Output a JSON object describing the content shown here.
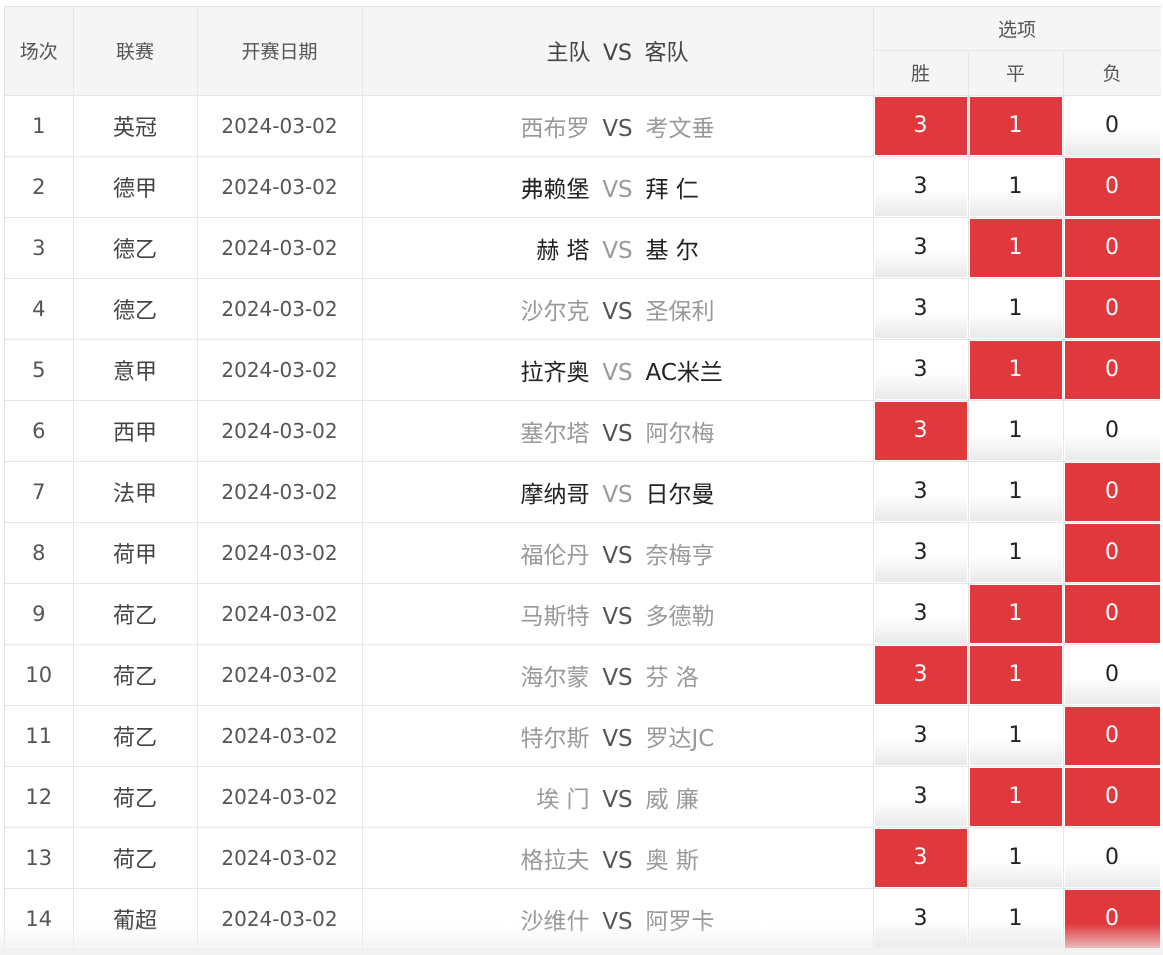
{
  "header": {
    "index": "场次",
    "league": "联赛",
    "date": "开赛日期",
    "teams_home": "主队",
    "teams_vs": "VS",
    "teams_away": "客队",
    "options": "选项",
    "win": "胜",
    "draw": "平",
    "lose": "负"
  },
  "colors": {
    "selected": "#e0393d",
    "header_bg": "#f5f5f5"
  },
  "rows": [
    {
      "index": "1",
      "league": "英冠",
      "date": "2024-03-02",
      "home": "西布罗",
      "vs": "VS",
      "away": "考文垂",
      "w": "3",
      "d": "1",
      "l": "0",
      "sel": [
        true,
        true,
        false
      ],
      "homeDim": true,
      "awayDim": true
    },
    {
      "index": "2",
      "league": "德甲",
      "date": "2024-03-02",
      "home": "弗赖堡",
      "vs": "VS",
      "away": "拜 仁",
      "w": "3",
      "d": "1",
      "l": "0",
      "sel": [
        false,
        false,
        true
      ],
      "homeDim": false,
      "awayDim": false
    },
    {
      "index": "3",
      "league": "德乙",
      "date": "2024-03-02",
      "home": "赫 塔",
      "vs": "VS",
      "away": "基 尔",
      "w": "3",
      "d": "1",
      "l": "0",
      "sel": [
        false,
        true,
        true
      ],
      "homeDim": false,
      "awayDim": false
    },
    {
      "index": "4",
      "league": "德乙",
      "date": "2024-03-02",
      "home": "沙尔克",
      "vs": "VS",
      "away": "圣保利",
      "w": "3",
      "d": "1",
      "l": "0",
      "sel": [
        false,
        false,
        true
      ],
      "homeDim": true,
      "awayDim": true
    },
    {
      "index": "5",
      "league": "意甲",
      "date": "2024-03-02",
      "home": "拉齐奥",
      "vs": "VS",
      "away": "AC米兰",
      "w": "3",
      "d": "1",
      "l": "0",
      "sel": [
        false,
        true,
        true
      ],
      "homeDim": false,
      "awayDim": false
    },
    {
      "index": "6",
      "league": "西甲",
      "date": "2024-03-02",
      "home": "塞尔塔",
      "vs": "VS",
      "away": "阿尔梅",
      "w": "3",
      "d": "1",
      "l": "0",
      "sel": [
        true,
        false,
        false
      ],
      "homeDim": true,
      "awayDim": true
    },
    {
      "index": "7",
      "league": "法甲",
      "date": "2024-03-02",
      "home": "摩纳哥",
      "vs": "VS",
      "away": "日尔曼",
      "w": "3",
      "d": "1",
      "l": "0",
      "sel": [
        false,
        false,
        true
      ],
      "homeDim": false,
      "awayDim": false
    },
    {
      "index": "8",
      "league": "荷甲",
      "date": "2024-03-02",
      "home": "福伦丹",
      "vs": "VS",
      "away": "奈梅亨",
      "w": "3",
      "d": "1",
      "l": "0",
      "sel": [
        false,
        false,
        true
      ],
      "homeDim": true,
      "awayDim": true
    },
    {
      "index": "9",
      "league": "荷乙",
      "date": "2024-03-02",
      "home": "马斯特",
      "vs": "VS",
      "away": "多德勒",
      "w": "3",
      "d": "1",
      "l": "0",
      "sel": [
        false,
        true,
        true
      ],
      "homeDim": true,
      "awayDim": true
    },
    {
      "index": "10",
      "league": "荷乙",
      "date": "2024-03-02",
      "home": "海尔蒙",
      "vs": "VS",
      "away": "芬 洛",
      "w": "3",
      "d": "1",
      "l": "0",
      "sel": [
        true,
        true,
        false
      ],
      "homeDim": true,
      "awayDim": true
    },
    {
      "index": "11",
      "league": "荷乙",
      "date": "2024-03-02",
      "home": "特尔斯",
      "vs": "VS",
      "away": "罗达JC",
      "w": "3",
      "d": "1",
      "l": "0",
      "sel": [
        false,
        false,
        true
      ],
      "homeDim": true,
      "awayDim": true
    },
    {
      "index": "12",
      "league": "荷乙",
      "date": "2024-03-02",
      "home": "埃 门",
      "vs": "VS",
      "away": "威 廉",
      "w": "3",
      "d": "1",
      "l": "0",
      "sel": [
        false,
        true,
        true
      ],
      "homeDim": true,
      "awayDim": true
    },
    {
      "index": "13",
      "league": "荷乙",
      "date": "2024-03-02",
      "home": "格拉夫",
      "vs": "VS",
      "away": "奥 斯",
      "w": "3",
      "d": "1",
      "l": "0",
      "sel": [
        true,
        false,
        false
      ],
      "homeDim": true,
      "awayDim": true
    },
    {
      "index": "14",
      "league": "葡超",
      "date": "2024-03-02",
      "home": "沙维什",
      "vs": "VS",
      "away": "阿罗卡",
      "w": "3",
      "d": "1",
      "l": "0",
      "sel": [
        false,
        false,
        true
      ],
      "homeDim": true,
      "awayDim": true
    }
  ]
}
